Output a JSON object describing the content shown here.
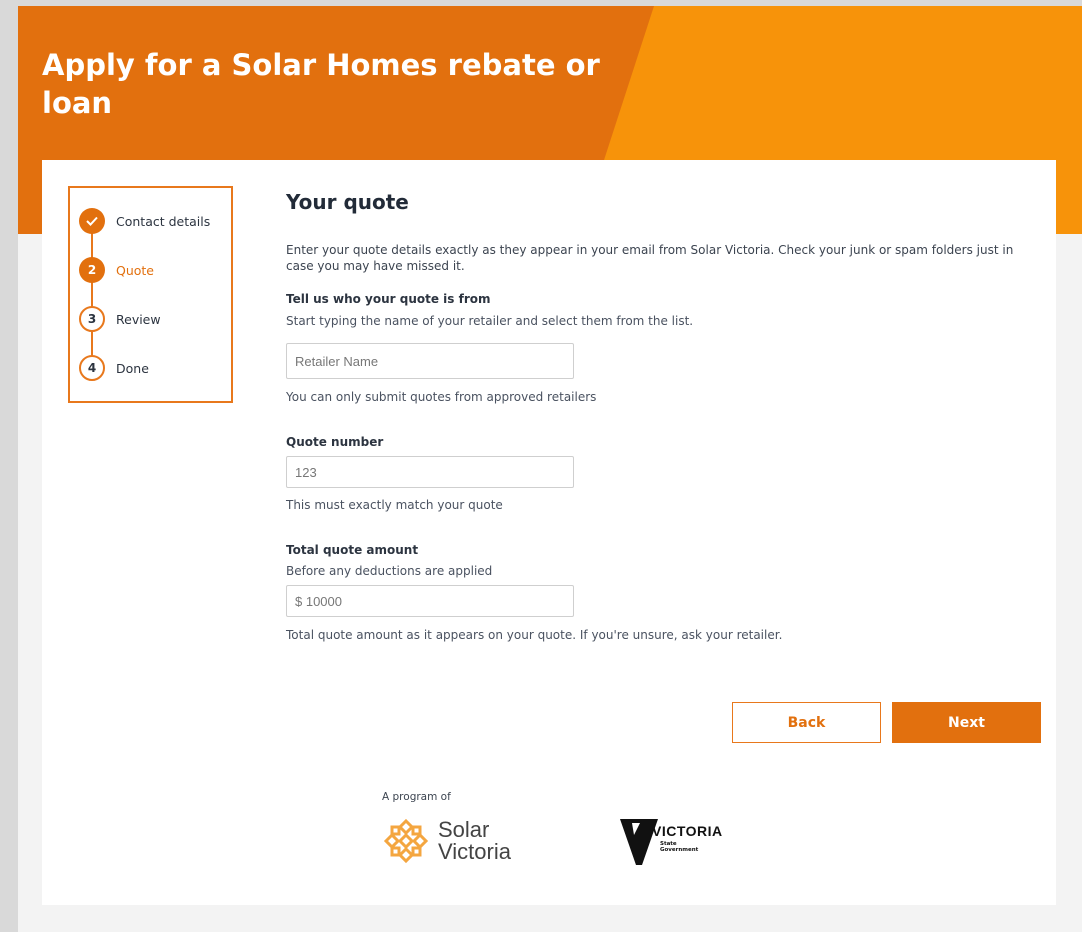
{
  "header": {
    "title": "Apply for a Solar Homes rebate or loan"
  },
  "colors": {
    "brand_dark_orange": "#e2700e",
    "brand_light_orange": "#f7930a"
  },
  "stepper": {
    "steps": [
      {
        "number": "✓",
        "label": "Contact details",
        "state": "done"
      },
      {
        "number": "2",
        "label": "Quote",
        "state": "active"
      },
      {
        "number": "3",
        "label": "Review",
        "state": "todo"
      },
      {
        "number": "4",
        "label": "Done",
        "state": "todo"
      }
    ]
  },
  "form": {
    "title": "Your quote",
    "intro": "Enter your quote details exactly as they appear in your email from Solar Victoria. Check your junk or spam folders just in case you may have missed it.",
    "retailer": {
      "label": "Tell us who your quote is from",
      "hint": "Start typing the name of your retailer and select them from the list.",
      "placeholder": "Retailer Name",
      "note": "You can only submit quotes from approved retailers"
    },
    "quote_number": {
      "label": "Quote number",
      "placeholder": "123",
      "note": "This must exactly match your quote"
    },
    "total_amount": {
      "label": "Total quote amount",
      "hint": "Before any deductions are applied",
      "placeholder": "$ 10000",
      "note": "Total quote amount as it appears on your quote. If you're unsure, ask your retailer."
    },
    "back_label": "Back",
    "next_label": "Next"
  },
  "footer": {
    "program_label": "A program of",
    "solar_victoria_line1": "Solar",
    "solar_victoria_line2": "Victoria",
    "vic_wordmark": "VICTORIA",
    "vic_sub_line1": "State",
    "vic_sub_line2": "Government"
  }
}
